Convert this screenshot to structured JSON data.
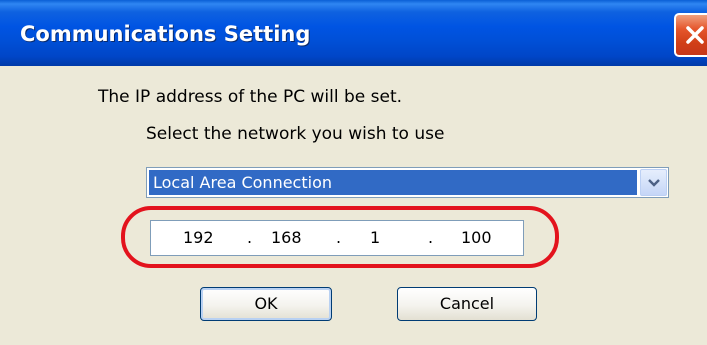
{
  "window": {
    "title": "Communications Setting"
  },
  "dialog": {
    "message": "The IP address of the PC will be set.",
    "prompt": "Select the network you wish to use",
    "network_select": {
      "selected": "Local Area Connection"
    },
    "ip_address": {
      "octets": [
        "192",
        "168",
        "1",
        "100"
      ],
      "separator": "."
    },
    "buttons": {
      "ok": "OK",
      "cancel": "Cancel"
    }
  },
  "colors": {
    "title_bar": "#0054e3",
    "dialog_background": "#ece9d8",
    "selection": "#316ac5",
    "highlight_ring": "#e3131d",
    "close_button": "#e5562c"
  },
  "icons": {
    "close": "close-icon",
    "dropdown": "chevron-down-icon"
  }
}
